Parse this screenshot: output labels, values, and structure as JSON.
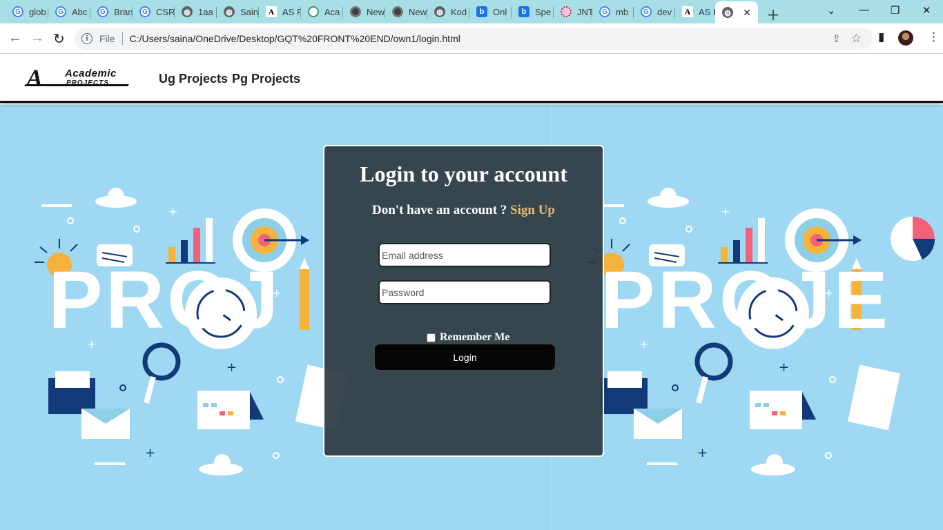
{
  "browser": {
    "tabs": [
      {
        "label": "glob",
        "icon": "google-icon"
      },
      {
        "label": "Abc",
        "icon": "google-icon"
      },
      {
        "label": "Bran",
        "icon": "google-icon"
      },
      {
        "label": "CSR",
        "icon": "google-icon"
      },
      {
        "label": "1aa",
        "icon": "globe-icon"
      },
      {
        "label": "Sain",
        "icon": "globe-icon"
      },
      {
        "label": "AS P",
        "icon": "a-logo-icon"
      },
      {
        "label": "Aca",
        "icon": "openai-icon"
      },
      {
        "label": "New",
        "icon": "chrome-icon"
      },
      {
        "label": "New",
        "icon": "chrome-icon"
      },
      {
        "label": "Kod",
        "icon": "globe-icon"
      },
      {
        "label": "Onl",
        "icon": "b-logo-icon"
      },
      {
        "label": "Spe",
        "icon": "b-logo-icon"
      },
      {
        "label": "JNT",
        "icon": "jnt-icon"
      },
      {
        "label": "mb",
        "icon": "google-icon"
      },
      {
        "label": "dev",
        "icon": "google-icon"
      },
      {
        "label": "AS P",
        "icon": "a-logo-icon"
      },
      {
        "label": "",
        "icon": "globe-icon",
        "active": true
      }
    ],
    "file_label": "File",
    "url": "C:/Users/saina/OneDrive/Desktop/GQT%20FRONT%20END/own1/login.html"
  },
  "site": {
    "logo_mark": "A",
    "logo_title": "Academic",
    "logo_subtitle": "PROJECTS",
    "nav": [
      "Ug Projects",
      "Pg Projects"
    ]
  },
  "background": {
    "word_left": "PROJ",
    "word_right": "PROJE"
  },
  "login": {
    "title": "Login to your account",
    "subtitle_prefix": "Don't have an account ? ",
    "signup_label": "Sign Up",
    "email_placeholder": "Email address",
    "password_placeholder": "Password",
    "remember_label": "Remember Me",
    "remember_checked": false,
    "button_label": "Login"
  },
  "colors": {
    "tabstrip": "#a8dfe6",
    "page_bg": "#9ed8f2",
    "card_bg": "#2d3a42",
    "signup_accent": "#e8b97a",
    "button_bg": "#050505"
  }
}
